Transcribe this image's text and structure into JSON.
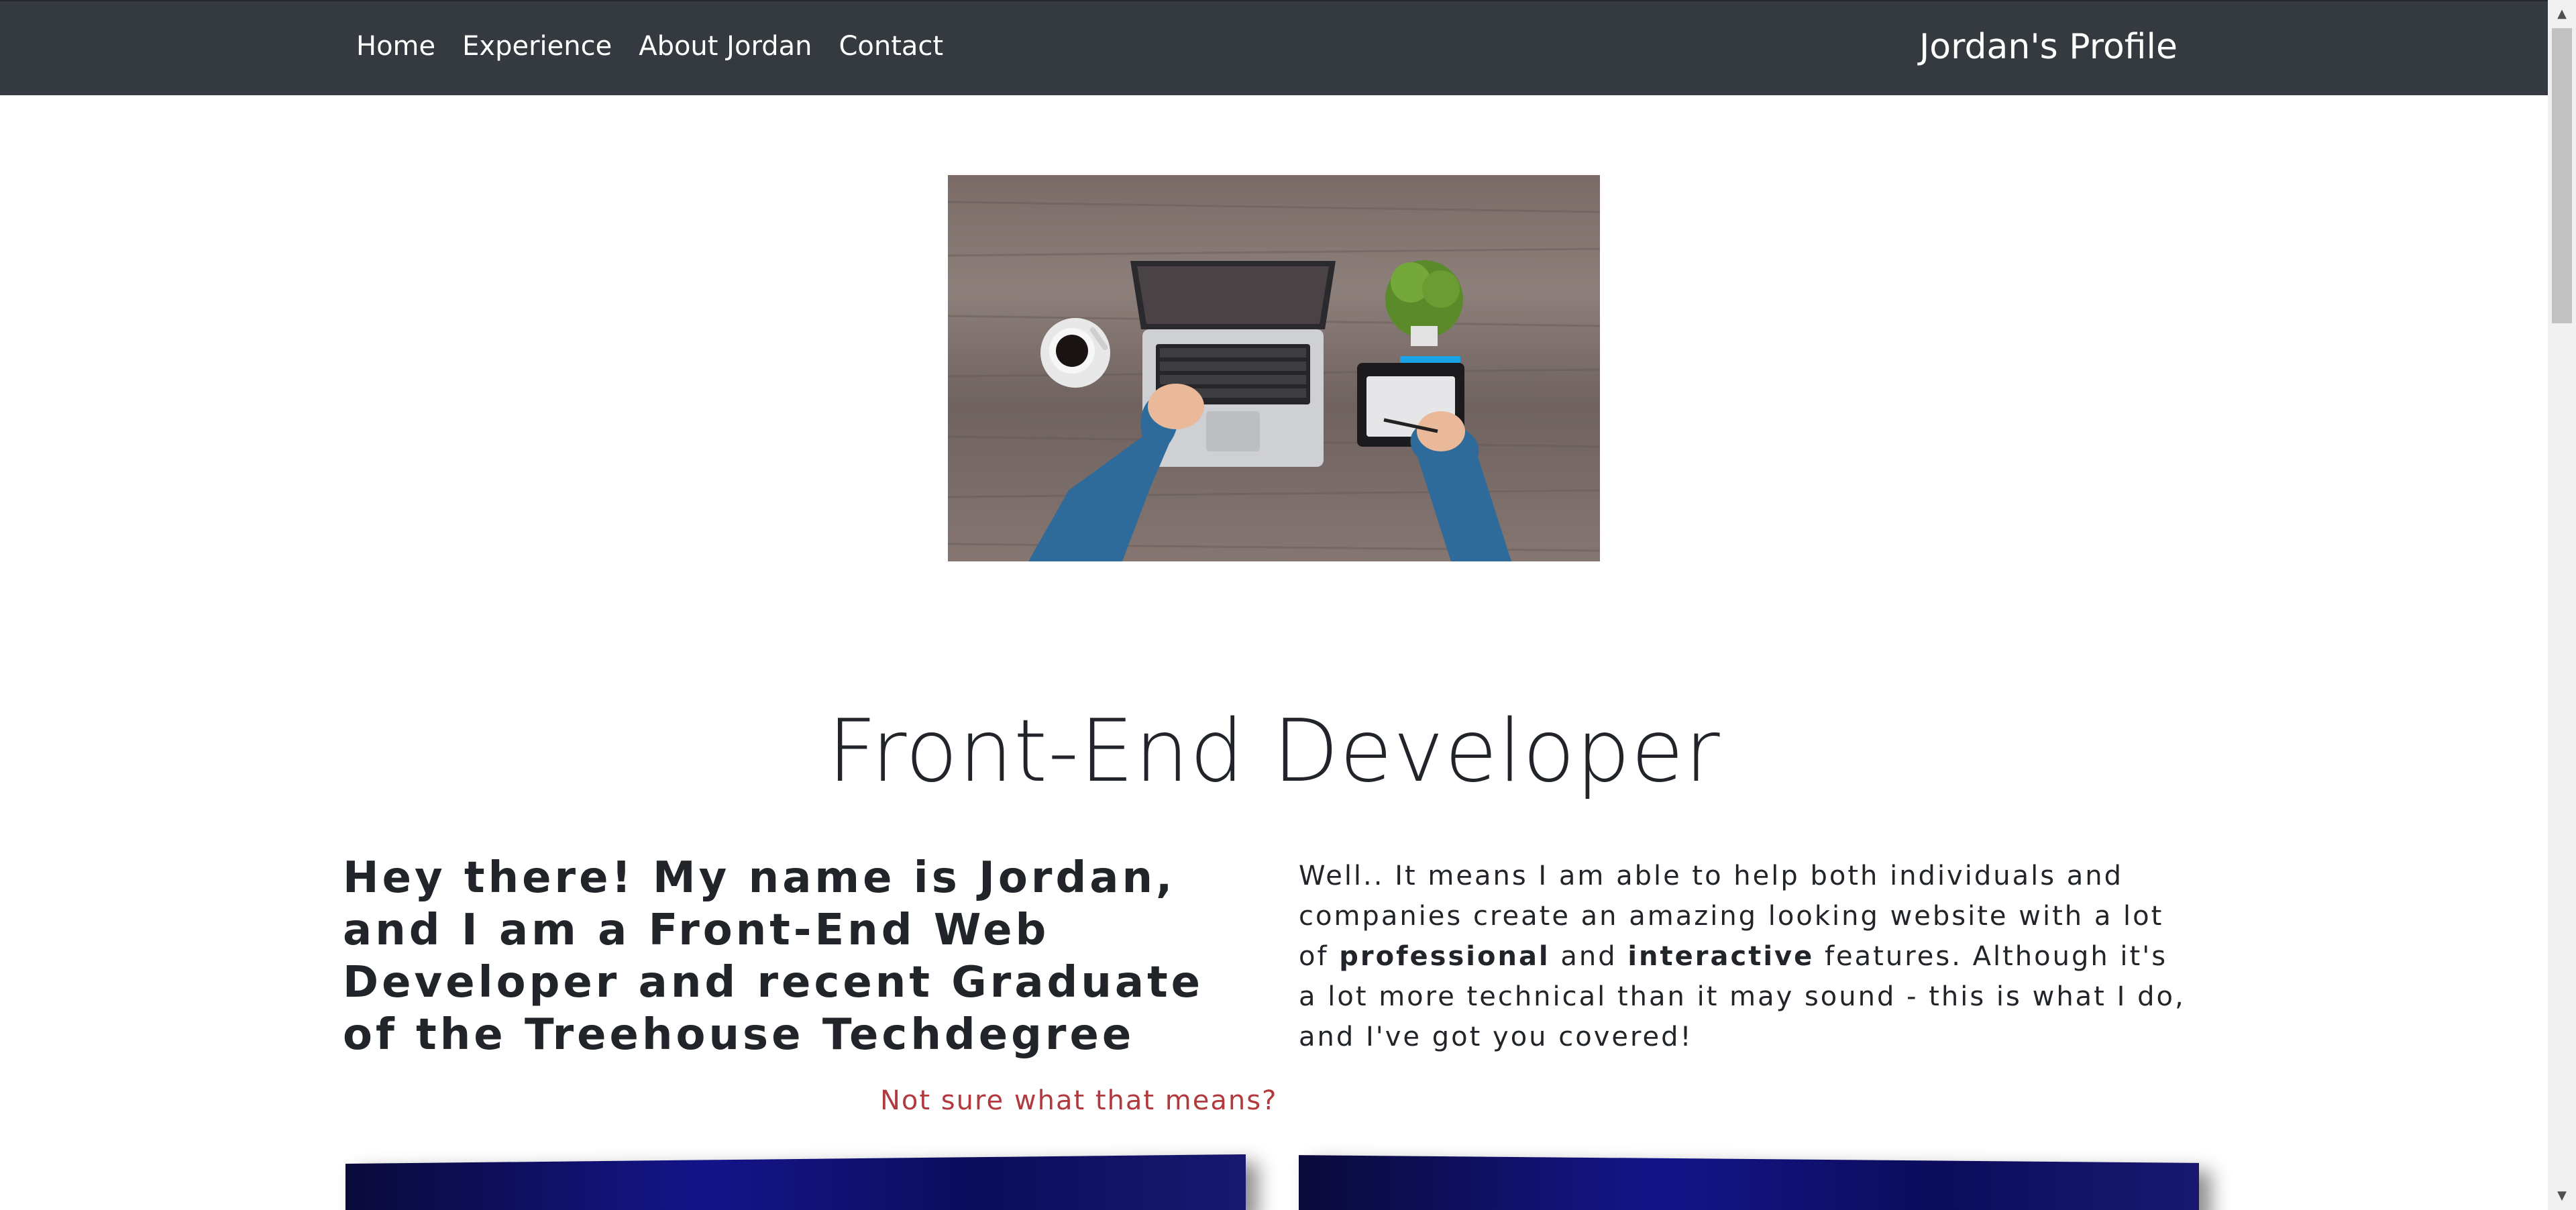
{
  "nav": {
    "links": [
      {
        "label": "Home"
      },
      {
        "label": "Experience"
      },
      {
        "label": "About Jordan"
      },
      {
        "label": "Contact"
      }
    ],
    "brand": "Jordan's Profile"
  },
  "hero": {
    "icon": "workspace-laptop-image"
  },
  "main": {
    "title": "Front-End Developer",
    "intro": "Hey there! My name is Jordan, and I am a Front-End Web Developer and recent Graduate of the Treehouse Techdegree",
    "cta": "Not sure what that means?",
    "para_part1": "Well.. It means I am able to help both individuals and companies create an amazing looking website with a lot of ",
    "para_bold1": "professional",
    "para_part2": " and ",
    "para_bold2": "interactive",
    "para_part3": " features. Although it's a lot more technical than it may sound - this is what I do, and I've got you covered!"
  },
  "colors": {
    "navbar": "#343a40",
    "accent_link": "#b23a3e",
    "text": "#212529"
  }
}
